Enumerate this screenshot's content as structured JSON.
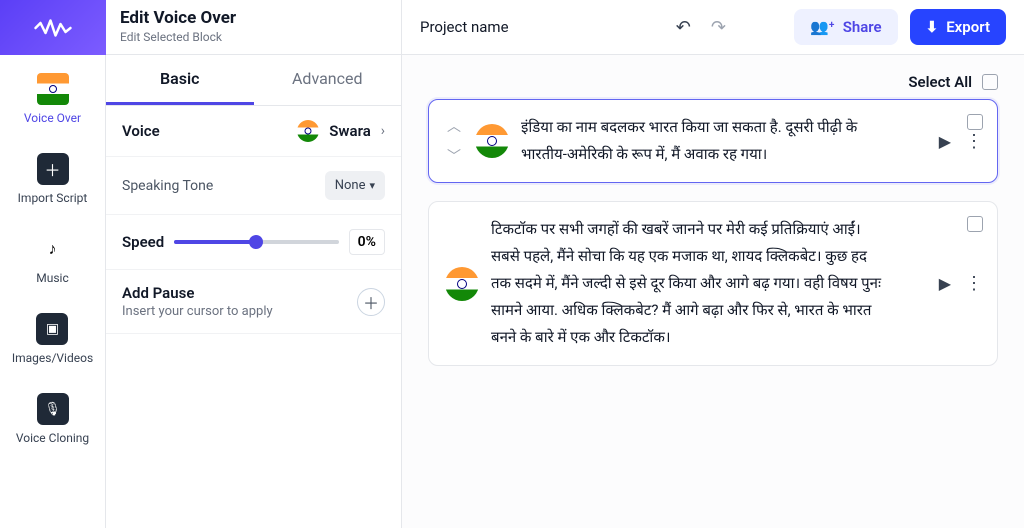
{
  "sidebar": {
    "items": [
      {
        "label": "Voice Over"
      },
      {
        "label": "Import Script"
      },
      {
        "label": "Music"
      },
      {
        "label": "Images/Videos"
      },
      {
        "label": "Voice Cloning"
      }
    ]
  },
  "panel": {
    "title": "Edit Voice Over",
    "subtitle": "Edit Selected Block",
    "tabs": {
      "basic": "Basic",
      "advanced": "Advanced"
    },
    "voice": {
      "label": "Voice",
      "value": "Swara"
    },
    "tone": {
      "label": "Speaking Tone",
      "value": "None"
    },
    "speed": {
      "label": "Speed",
      "value": "0%"
    },
    "pause": {
      "title": "Add Pause",
      "sub": "Insert your cursor to apply"
    }
  },
  "topbar": {
    "project_name": "Project name",
    "share": "Share",
    "export": "Export"
  },
  "main": {
    "select_all": "Select All",
    "blocks": [
      {
        "text": "इंडिया का नाम बदलकर भारत किया जा सकता है. दूसरी पीढ़ी के भारतीय-अमेरिकी के रूप में, मैं अवाक रह गया।"
      },
      {
        "text": "टिकटॉक पर सभी जगहों की खबरें जानने पर मेरी कई प्रतिक्रियाएं आईं। सबसे पहले, मैंने सोचा कि यह एक मजाक था, शायद क्लिकबेट। कुछ हद तक सदमे में, मैंने जल्दी से इसे दूर किया और आगे बढ़ गया। वही विषय पुनः सामने आया. अधिक क्लिकबेट? मैं आगे बढ़ा और फिर से, भारत के भारत बनने के बारे में एक और टिकटॉक।"
      }
    ]
  }
}
